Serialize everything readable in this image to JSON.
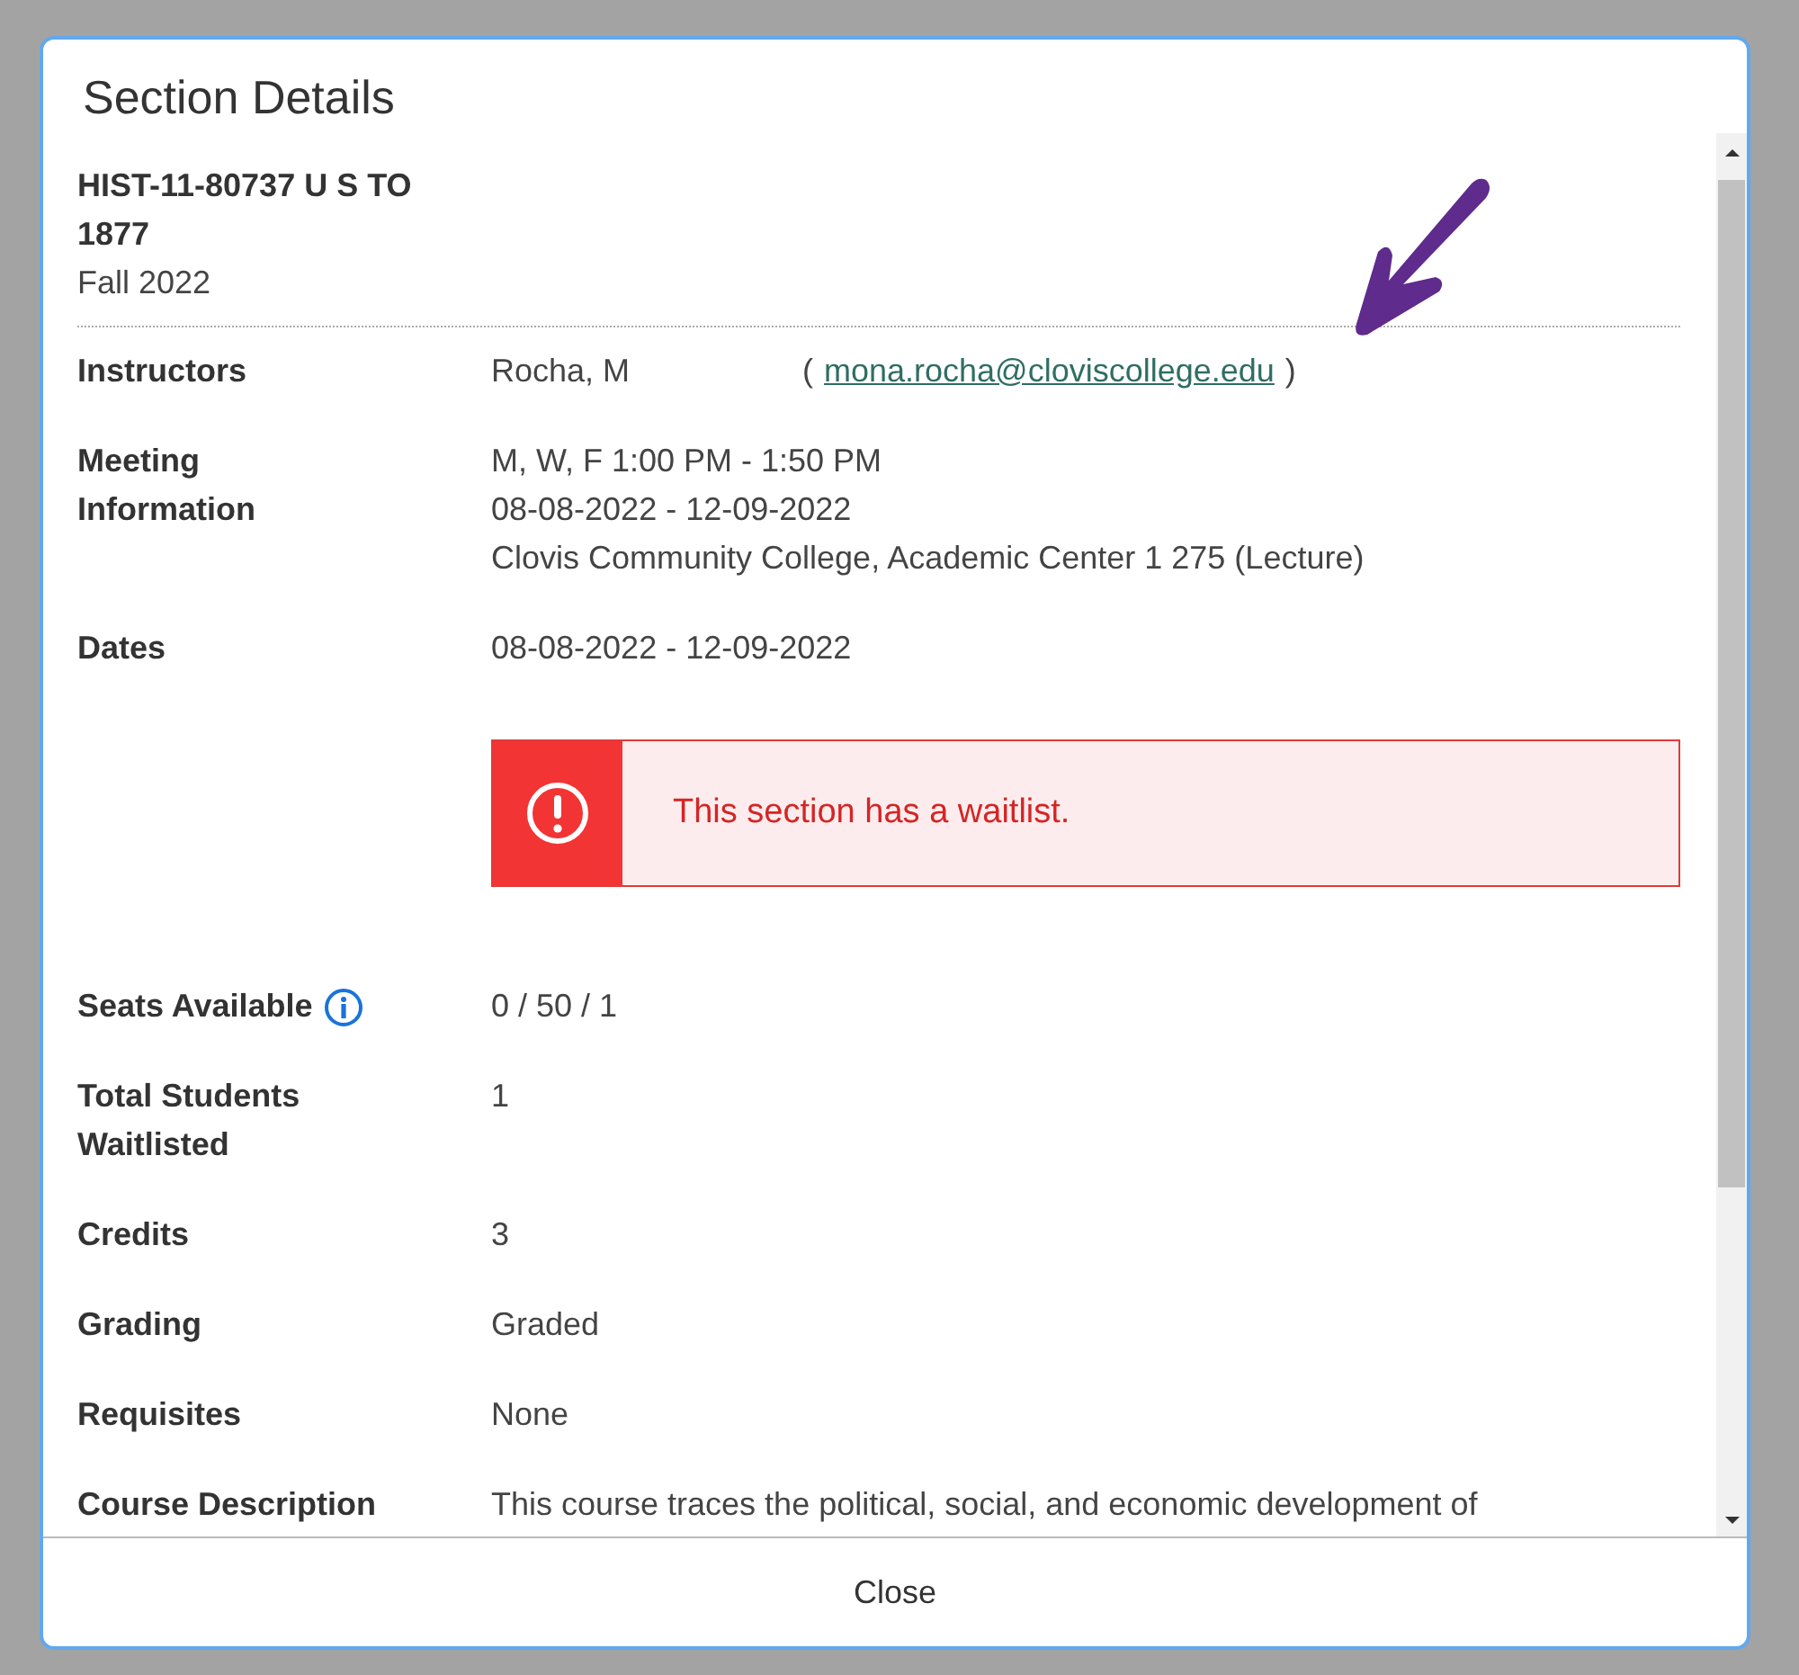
{
  "dialog": {
    "title": "Section Details",
    "course": "HIST-11-80737 U S TO 1877",
    "term": "Fall 2022",
    "details": [
      {
        "kind": "instructor",
        "label": "Instructors",
        "name": "Rocha, M",
        "open": "(",
        "email": "mona.rocha@cloviscollege.edu",
        "close": ")"
      },
      {
        "kind": "lines",
        "label": "Meeting Information",
        "lines": [
          "M, W, F 1:00 PM - 1:50 PM",
          "08-08-2022 - 12-09-2022",
          "Clovis Community College, Academic Center 1 275 (Lecture)"
        ]
      },
      {
        "kind": "text",
        "label": "Dates",
        "value": "08-08-2022 - 12-09-2022"
      },
      {
        "kind": "alert",
        "value": "This section has a waitlist."
      },
      {
        "kind": "info",
        "label": "Seats Available",
        "value": "0 / 50 / 1"
      },
      {
        "kind": "text",
        "label": "Total Students Waitlisted",
        "value": "1"
      },
      {
        "kind": "text",
        "label": "Credits",
        "value": "3"
      },
      {
        "kind": "text",
        "label": "Grading",
        "value": "Graded"
      },
      {
        "kind": "text",
        "label": "Requisites",
        "value": "None"
      },
      {
        "kind": "text",
        "label": "Course Description",
        "value": "This course traces the political, social, and economic development of"
      }
    ],
    "button": "Close"
  }
}
